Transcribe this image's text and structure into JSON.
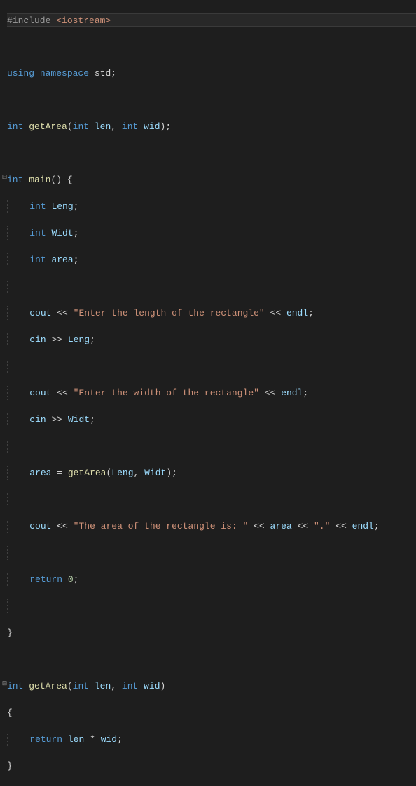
{
  "code": {
    "l1_pre": "#include ",
    "l1_inc": "<iostream>",
    "l3_using": "using",
    "l3_ns": "namespace",
    "l3_std": "std",
    "int": "int",
    "getArea": "getArea",
    "len": "len",
    "wid": "wid",
    "main": "main",
    "Leng": "Leng",
    "Widt": "Widt",
    "area": "area",
    "cout": "cout",
    "cin": "cin",
    "endl": "endl",
    "return": "return",
    "zero": "0",
    "str_len": "\"Enter the length of the rectangle\"",
    "str_wid": "\"Enter the width of the rectangle\"",
    "str_area": "\"The area of the rectangle is: \"",
    "str_dot": "\".\"",
    "op_ins": "<<",
    "op_ext": ">>",
    "op_eq": "=",
    "op_mul": "*",
    "semi": ";",
    "comma": ",",
    "lparen": "(",
    "rparen": ")",
    "lbrace": "{",
    "rbrace": "}",
    "space": " "
  }
}
